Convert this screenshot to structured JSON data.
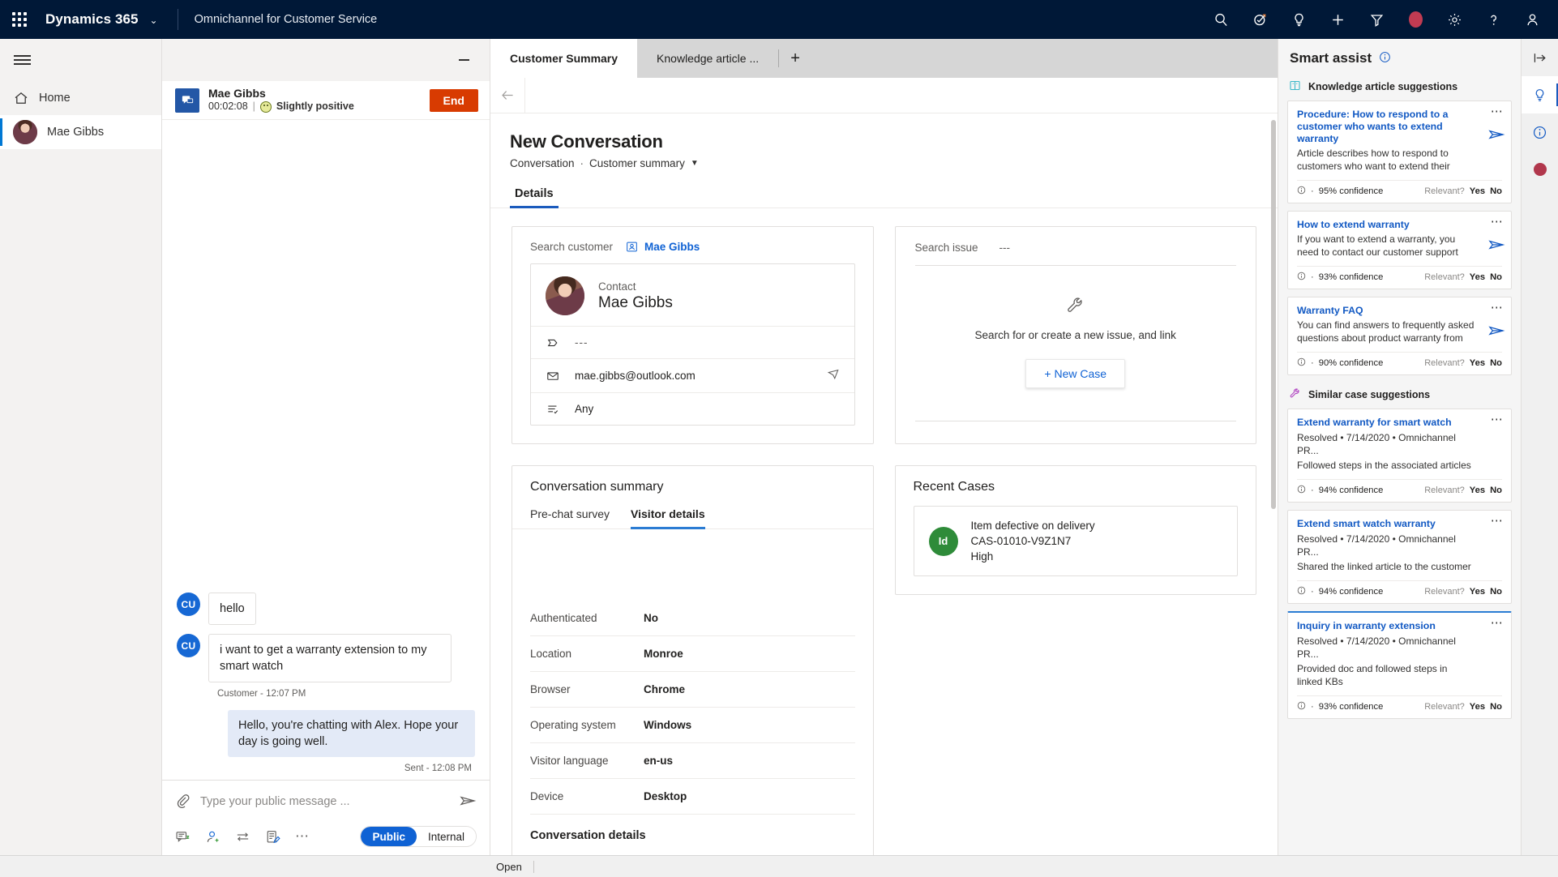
{
  "topnav": {
    "waffle": "app-launcher",
    "brand": "Dynamics 365",
    "app_name": "Omnichannel for Customer Service",
    "icons": [
      "search-icon",
      "assistant-icon",
      "lightbulb-icon",
      "plus-icon",
      "filter-icon",
      "presence-dot",
      "settings-gear-icon",
      "help-icon",
      "user-account-icon"
    ]
  },
  "sessions": {
    "home_label": "Home",
    "active_label": "Mae Gibbs"
  },
  "chat": {
    "customer_name": "Mae Gibbs",
    "timer": "00:02:08",
    "separator": "|",
    "sentiment": "Slightly positive",
    "end_label": "End",
    "messages": [
      {
        "author": "CU",
        "text": "hello",
        "side": "in"
      },
      {
        "author": "CU",
        "text": "i want to get a warranty extension to my smart watch",
        "side": "in"
      }
    ],
    "in_meta": "Customer - 12:07 PM",
    "agent_message": "Hello, you're chatting with Alex. Hope your day is going well.",
    "agent_meta": "Sent - 12:08 PM",
    "composer_placeholder": "Type your public message ...",
    "tools": [
      "quick-replies-icon",
      "add-participant-icon",
      "transfer-icon",
      "notes-icon",
      "more-options-icon"
    ],
    "mode_public": "Public",
    "mode_internal": "Internal"
  },
  "tabs": {
    "items": [
      {
        "label": "Customer Summary",
        "active": true
      },
      {
        "label": "Knowledge article ...",
        "active": false
      }
    ],
    "add_label": "+"
  },
  "page": {
    "title": "New Conversation",
    "breadcrumb_entity": "Conversation",
    "breadcrumb_sep": "·",
    "breadcrumb_form": "Customer summary",
    "details_tab": "Details"
  },
  "customer_card": {
    "search_label": "Search customer",
    "chip_name": "Mae Gibbs",
    "contact_label": "Contact",
    "contact_name": "Mae Gibbs",
    "fields": [
      {
        "icon": "tag-icon",
        "value": "---",
        "dim": true,
        "trail": ""
      },
      {
        "icon": "mail-icon",
        "value": "mae.gibbs@outlook.com",
        "dim": false,
        "trail": "send-email-icon"
      },
      {
        "icon": "preferences-icon",
        "value": "Any",
        "dim": false,
        "trail": ""
      }
    ]
  },
  "issue_card": {
    "search_label": "Search issue",
    "search_value": "---",
    "empty_icon": "wrench-icon",
    "empty_text": "Search for or create a new issue, and link",
    "new_case_label": "+ New Case"
  },
  "conversation_summary": {
    "title": "Conversation summary",
    "tabs": [
      {
        "label": "Pre-chat survey",
        "active": false
      },
      {
        "label": "Visitor details",
        "active": true
      }
    ],
    "rows": [
      {
        "key": "Authenticated",
        "value": "No"
      },
      {
        "key": "Location",
        "value": "Monroe"
      },
      {
        "key": "Browser",
        "value": "Chrome"
      },
      {
        "key": "Operating system",
        "value": "Windows"
      },
      {
        "key": "Visitor language",
        "value": "en-us"
      },
      {
        "key": "Device",
        "value": "Desktop"
      }
    ],
    "more_section": "Conversation details"
  },
  "recent_cases": {
    "title": "Recent Cases",
    "items": [
      {
        "badge": "Id",
        "title": "Item defective on delivery",
        "number": "CAS-01010-V9Z1N7",
        "priority": "High"
      }
    ]
  },
  "smart_assist": {
    "title": "Smart assist",
    "info_icon": "info-icon",
    "groups": [
      {
        "icon": "knowledge-book-icon",
        "heading": "Knowledge article suggestions",
        "items": [
          {
            "title": "Procedure: How to respond to a customer who wants to extend warranty",
            "desc": "Article describes how to respond to customers who want to extend their",
            "confidence": "95% confidence",
            "relevant_label": "Relevant?",
            "yes": "Yes",
            "no": "No",
            "highlight": false
          },
          {
            "title": "How to extend warranty",
            "desc": "If you want to extend a warranty, you need to contact our customer support",
            "confidence": "93% confidence",
            "relevant_label": "Relevant?",
            "yes": "Yes",
            "no": "No",
            "highlight": false
          },
          {
            "title": "Warranty FAQ",
            "desc": "You can find answers to frequently asked questions about product warranty from",
            "confidence": "90% confidence",
            "relevant_label": "Relevant?",
            "yes": "Yes",
            "no": "No",
            "highlight": false
          }
        ]
      },
      {
        "icon": "wrench-icon",
        "heading": "Similar case suggestions",
        "items": [
          {
            "title": "Extend warranty for smart watch",
            "sub": "Resolved • 7/14/2020 • Omnichannel PR...",
            "desc": "Followed steps in the associated articles",
            "confidence": "94% confidence",
            "relevant_label": "Relevant?",
            "yes": "Yes",
            "no": "No",
            "highlight": false
          },
          {
            "title": "Extend smart watch warranty",
            "sub": "Resolved • 7/14/2020 • Omnichannel PR...",
            "desc": "Shared the linked article to the customer",
            "confidence": "94% confidence",
            "relevant_label": "Relevant?",
            "yes": "Yes",
            "no": "No",
            "highlight": false
          },
          {
            "title": "Inquiry in warranty extension",
            "sub": "Resolved • 7/14/2020 • Omnichannel PR...",
            "desc": "Provided doc and followed steps in linked KBs",
            "confidence": "93% confidence",
            "relevant_label": "Relevant?",
            "yes": "Yes",
            "no": "No",
            "highlight": true
          }
        ]
      }
    ]
  },
  "rail": {
    "items": [
      "expand-panel-icon",
      "smart-assist-lightbulb-icon",
      "info-icon",
      "presence-dot-icon"
    ]
  },
  "statusbar": {
    "status": "Open"
  },
  "colors": {
    "nav_bg": "#001837",
    "accent": "#0f62d4",
    "end_button": "#d83b01",
    "tab_underline": "#1b5bbd",
    "case_badge": "#2e8b39",
    "presence": "#c13b52"
  }
}
